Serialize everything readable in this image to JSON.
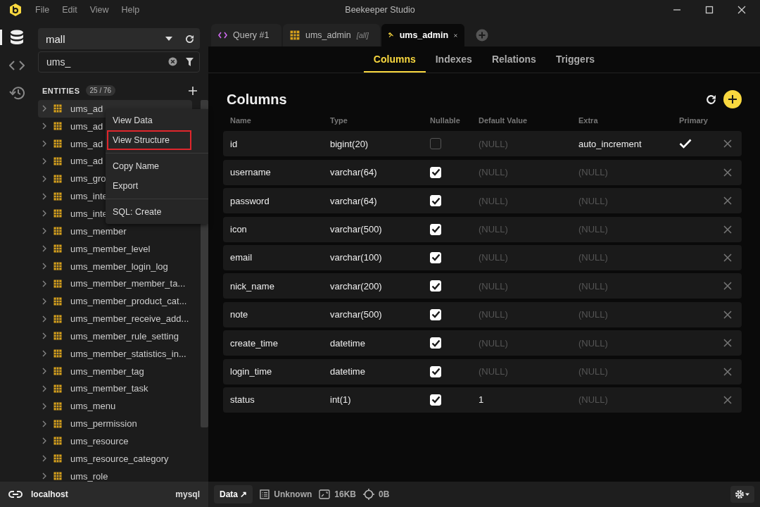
{
  "app": {
    "title": "Beekeeper Studio",
    "menu": [
      "File",
      "Edit",
      "View",
      "Help"
    ]
  },
  "activity_bar": [
    {
      "kind": "database",
      "selected": true
    },
    {
      "kind": "code",
      "selected": false
    },
    {
      "kind": "history",
      "selected": false
    }
  ],
  "sidebar": {
    "database": "mall",
    "filter": "ums_",
    "entities_label": "ENTITIES",
    "entities_count": "25 / 76",
    "items": [
      {
        "name": "ums_ad",
        "hovered": true
      },
      {
        "name": "ums_ad",
        "hovered": false
      },
      {
        "name": "ums_ad",
        "hovered": false
      },
      {
        "name": "ums_ad",
        "hovered": false
      },
      {
        "name": "ums_gro",
        "hovered": false
      },
      {
        "name": "ums_inte",
        "hovered": false
      },
      {
        "name": "ums_inte",
        "hovered": false
      },
      {
        "name": "ums_member",
        "hovered": false
      },
      {
        "name": "ums_member_level",
        "hovered": false
      },
      {
        "name": "ums_member_login_log",
        "hovered": false
      },
      {
        "name": "ums_member_member_ta...",
        "hovered": false
      },
      {
        "name": "ums_member_product_cat...",
        "hovered": false
      },
      {
        "name": "ums_member_receive_add...",
        "hovered": false
      },
      {
        "name": "ums_member_rule_setting",
        "hovered": false
      },
      {
        "name": "ums_member_statistics_in...",
        "hovered": false
      },
      {
        "name": "ums_member_tag",
        "hovered": false
      },
      {
        "name": "ums_member_task",
        "hovered": false
      },
      {
        "name": "ums_menu",
        "hovered": false
      },
      {
        "name": "ums_permission",
        "hovered": false
      },
      {
        "name": "ums_resource",
        "hovered": false
      },
      {
        "name": "ums_resource_category",
        "hovered": false
      },
      {
        "name": "ums_role",
        "hovered": false
      }
    ]
  },
  "context_menu": {
    "groups": [
      [
        {
          "label": "View Data",
          "highlighted": false
        },
        {
          "label": "View Structure",
          "highlighted": true
        }
      ],
      [
        {
          "label": "Copy Name",
          "highlighted": false
        },
        {
          "label": "Export",
          "highlighted": false
        }
      ],
      [
        {
          "label": "SQL: Create",
          "highlighted": false
        }
      ]
    ]
  },
  "tabs": [
    {
      "kind": "query",
      "label": "Query #1",
      "selected": false
    },
    {
      "kind": "table",
      "label": "ums_admin",
      "suffix": "[all]",
      "selected": false
    },
    {
      "kind": "structure",
      "label": "ums_admin",
      "selected": true
    }
  ],
  "subtabs": [
    {
      "label": "Columns",
      "selected": true
    },
    {
      "label": "Indexes",
      "selected": false
    },
    {
      "label": "Relations",
      "selected": false
    },
    {
      "label": "Triggers",
      "selected": false
    }
  ],
  "columns_panel": {
    "title": "Columns",
    "headers": [
      "Name",
      "Type",
      "Nullable",
      "Default Value",
      "Extra",
      "Primary"
    ],
    "rows": [
      {
        "name": "id",
        "type": "bigint(20)",
        "nullable": false,
        "default": {
          "text": "(NULL)",
          "null": true
        },
        "extra": {
          "text": "auto_increment",
          "null": false
        },
        "primary": true
      },
      {
        "name": "username",
        "type": "varchar(64)",
        "nullable": true,
        "default": {
          "text": "(NULL)",
          "null": true
        },
        "extra": {
          "text": "(NULL)",
          "null": true
        },
        "primary": false
      },
      {
        "name": "password",
        "type": "varchar(64)",
        "nullable": true,
        "default": {
          "text": "(NULL)",
          "null": true
        },
        "extra": {
          "text": "(NULL)",
          "null": true
        },
        "primary": false
      },
      {
        "name": "icon",
        "type": "varchar(500)",
        "nullable": true,
        "default": {
          "text": "(NULL)",
          "null": true
        },
        "extra": {
          "text": "(NULL)",
          "null": true
        },
        "primary": false
      },
      {
        "name": "email",
        "type": "varchar(100)",
        "nullable": true,
        "default": {
          "text": "(NULL)",
          "null": true
        },
        "extra": {
          "text": "(NULL)",
          "null": true
        },
        "primary": false
      },
      {
        "name": "nick_name",
        "type": "varchar(200)",
        "nullable": true,
        "default": {
          "text": "(NULL)",
          "null": true
        },
        "extra": {
          "text": "(NULL)",
          "null": true
        },
        "primary": false
      },
      {
        "name": "note",
        "type": "varchar(500)",
        "nullable": true,
        "default": {
          "text": "(NULL)",
          "null": true
        },
        "extra": {
          "text": "(NULL)",
          "null": true
        },
        "primary": false
      },
      {
        "name": "create_time",
        "type": "datetime",
        "nullable": true,
        "default": {
          "text": "(NULL)",
          "null": true
        },
        "extra": {
          "text": "(NULL)",
          "null": true
        },
        "primary": false
      },
      {
        "name": "login_time",
        "type": "datetime",
        "nullable": true,
        "default": {
          "text": "(NULL)",
          "null": true
        },
        "extra": {
          "text": "(NULL)",
          "null": true
        },
        "primary": false
      },
      {
        "name": "status",
        "type": "int(1)",
        "nullable": true,
        "default": {
          "text": "1",
          "null": false
        },
        "extra": {
          "text": "(NULL)",
          "null": true
        },
        "primary": false
      }
    ]
  },
  "footer": {
    "host": "localhost",
    "dialect": "mysql",
    "data_button": "Data ↗",
    "row_count": "Unknown",
    "size": "16KB",
    "offset": "0B"
  }
}
